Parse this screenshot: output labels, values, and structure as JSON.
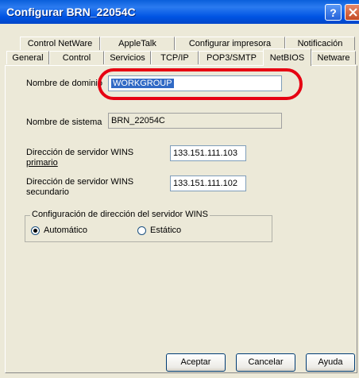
{
  "window": {
    "title": "Configurar BRN_22054C"
  },
  "tabs": {
    "row1": [
      "Control NetWare",
      "AppleTalk",
      "Configurar impresora",
      "Notificación"
    ],
    "row2": [
      "General",
      "Control",
      "Servicios",
      "TCP/IP",
      "POP3/SMTP",
      "NetBIOS",
      "Netware"
    ],
    "active": "NetBIOS"
  },
  "form": {
    "domain_label": "Nombre de dominio",
    "domain_value": "WORKGROUP",
    "system_label": "Nombre de sistema",
    "system_value": "BRN_22054C",
    "wins_primary_label_1": "Dirección de servidor WINS",
    "wins_primary_label_2": "primario",
    "wins_primary_value": "133.151.111.103",
    "wins_secondary_label_1": "Dirección de servidor WINS",
    "wins_secondary_label_2": "secundario",
    "wins_secondary_value": "133.151.111.102",
    "wins_group_title": "Configuración de dirección del servidor WINS",
    "radio_auto": "Automático",
    "radio_static": "Estático",
    "selected_mode": "Automático"
  },
  "buttons": {
    "accept": "Aceptar",
    "cancel": "Cancelar",
    "help": "Ayuda"
  },
  "colors": {
    "titlebar": "#0054e3",
    "highlight_ring": "#e60012",
    "selection": "#316ac5"
  }
}
